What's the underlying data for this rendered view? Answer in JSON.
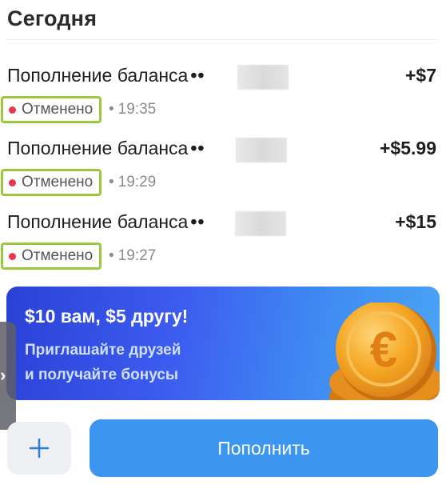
{
  "section": {
    "title": "Сегодня"
  },
  "transactions": [
    {
      "title": "Пополнение баланса",
      "masked": "••",
      "amount": "+$7",
      "status": "Отменено",
      "time": "19:35"
    },
    {
      "title": "Пополнение баланса",
      "masked": "••",
      "amount": "+$5.99",
      "status": "Отменено",
      "time": "19:29"
    },
    {
      "title": "Пополнение баланса",
      "masked": "••",
      "amount": "+$15",
      "status": "Отменено",
      "time": "19:27"
    }
  ],
  "banner": {
    "title": "$10 вам, $5 другу!",
    "subtitle_line1": "Приглашайте друзей",
    "subtitle_line2": "и получайте бонусы",
    "coin_symbol": "€"
  },
  "actions": {
    "topup_label": "Пополнить",
    "add_icon": "plus-icon"
  },
  "colors": {
    "status_dot": "#e8384f",
    "highlight_box": "#9bc83f",
    "primary": "#3c95ef"
  }
}
